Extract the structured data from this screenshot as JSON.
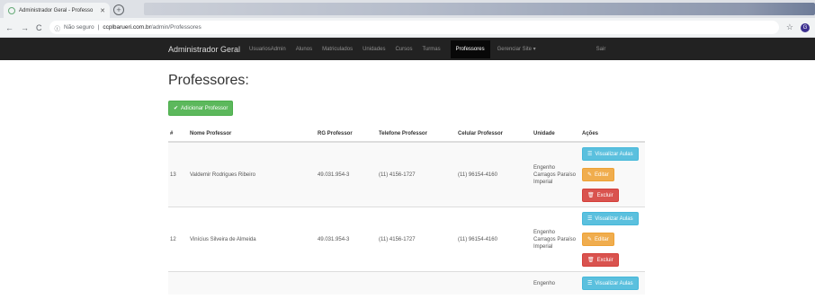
{
  "browser": {
    "tab_title": "Administrador Geral - Professo",
    "url_security": "Não seguro",
    "url_host": "ccplbarueri.com.br",
    "url_path": "/admin/Professores",
    "profile_initial": "G"
  },
  "navbar": {
    "brand": "Administrador Geral",
    "links": [
      "UsuariosAdmin",
      "Alunos",
      "Matriculados",
      "Unidades",
      "Cursos",
      "Turmas",
      "Professores",
      "Gerenciar Site ▾",
      "Sair"
    ]
  },
  "page": {
    "title": "Professores:",
    "add_button": "Adicionar Professor"
  },
  "table": {
    "headers": [
      "#",
      "Nome Professor",
      "RG Professor",
      "Telefone Professor",
      "Celular Professor",
      "Unidade",
      "Ações"
    ],
    "rows": [
      {
        "id": "13",
        "name": "Valdemir Rodrigues Ribeiro",
        "rg": "49.031.954-3",
        "tel": "(11) 4156-1727",
        "cel": "(11) 96154-4160",
        "unit": "Engenho Carragos Paraíso Imperial"
      },
      {
        "id": "12",
        "name": "Vinícius Silveira de Almeida",
        "rg": "49.031.954-3",
        "tel": "(11) 4156-1727",
        "cel": "(11) 96154-4160",
        "unit": "Engenho Carragos Paraíso Imperial"
      },
      {
        "id": "",
        "name": "",
        "rg": "",
        "tel": "",
        "cel": "",
        "unit": "Engenho"
      }
    ],
    "actions": {
      "view": "Visualizar Aulas",
      "edit": "Editar",
      "delete": "Excluir"
    }
  },
  "colors": {
    "navbar_bg": "#222222",
    "success": "#5cb85c",
    "info": "#5bc0de",
    "warning": "#f0ad4e",
    "danger": "#d9534f"
  }
}
